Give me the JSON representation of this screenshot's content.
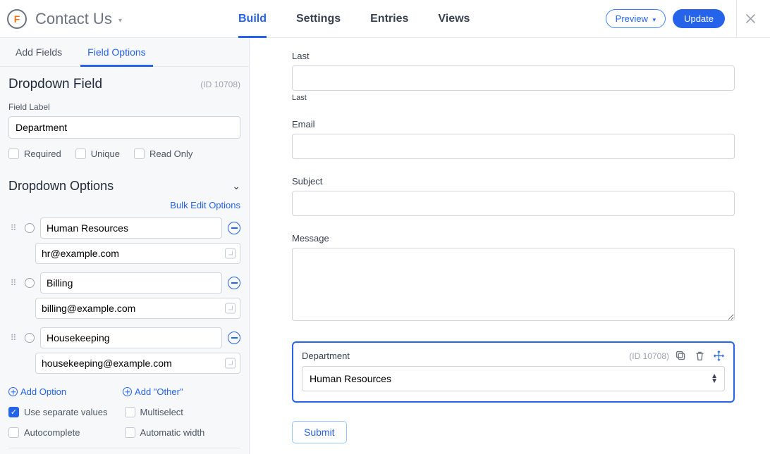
{
  "header": {
    "form_title": "Contact Us",
    "tabs": {
      "build": "Build",
      "settings": "Settings",
      "entries": "Entries",
      "views": "Views"
    },
    "preview": "Preview",
    "update": "Update"
  },
  "sidebar": {
    "tabs": {
      "add_fields": "Add Fields",
      "field_options": "Field Options"
    },
    "panel_title": "Dropdown Field",
    "panel_id": "(ID 10708)",
    "field_label_label": "Field Label",
    "field_label_value": "Department",
    "checks": {
      "required": "Required",
      "unique": "Unique",
      "readonly": "Read Only"
    },
    "options_title": "Dropdown Options",
    "bulk_edit": "Bulk Edit Options",
    "options": [
      {
        "label": "Human Resources",
        "value": "hr@example.com"
      },
      {
        "label": "Billing",
        "value": "billing@example.com"
      },
      {
        "label": "Housekeeping",
        "value": "housekeeping@example.com"
      }
    ],
    "add_option": "Add Option",
    "add_other": "Add \"Other\"",
    "settings": {
      "separate_values": "Use separate values",
      "multiselect": "Multiselect",
      "autocomplete": "Autocomplete",
      "auto_width": "Automatic width"
    }
  },
  "canvas": {
    "last": "Last",
    "last_sub": "Last",
    "email": "Email",
    "subject": "Subject",
    "message": "Message",
    "department_label": "Department",
    "department_id": "(ID 10708)",
    "department_value": "Human Resources",
    "submit": "Submit"
  }
}
